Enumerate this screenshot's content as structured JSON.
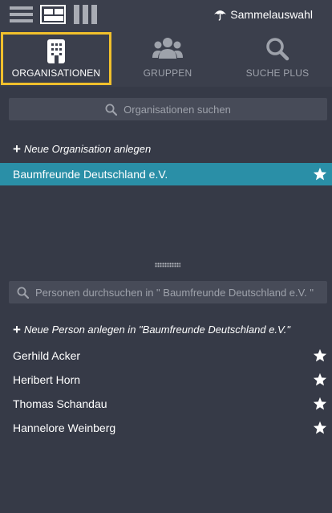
{
  "topbar": {
    "view_options": [
      "list-view",
      "grid-view",
      "columns-view"
    ],
    "sammelauswahl_label": "Sammelauswahl",
    "sammelauswahl_icon": "umbrella-icon"
  },
  "tabs": [
    {
      "label": "ORGANISATIONEN",
      "icon": "building-icon",
      "active": true
    },
    {
      "label": "GRUPPEN",
      "icon": "group-icon",
      "active": false
    },
    {
      "label": "SUCHE PLUS",
      "icon": "search-icon",
      "active": false
    }
  ],
  "organisations": {
    "search_placeholder": "Organisationen suchen",
    "add_label": "Neue Organisation anlegen",
    "items": [
      {
        "name": "Baumfreunde Deutschland e.V.",
        "selected": true,
        "favorite": true
      }
    ]
  },
  "persons": {
    "search_placeholder": "Personen durchsuchen in \" Baumfreunde Deutschland e.V. \"",
    "add_label": "Neue Person anlegen in \"Baumfreunde Deutschland e.V.\"",
    "items": [
      {
        "name": "Gerhild Acker",
        "favorite": true
      },
      {
        "name": "Heribert Horn",
        "favorite": true
      },
      {
        "name": "Thomas Schandau",
        "favorite": true
      },
      {
        "name": "Hannelore Weinberg",
        "favorite": true
      }
    ]
  },
  "colors": {
    "background": "#363a47",
    "selected_row": "#2a8fa7",
    "active_tab_border": "#f1c02c",
    "search_field": "#474b58"
  }
}
